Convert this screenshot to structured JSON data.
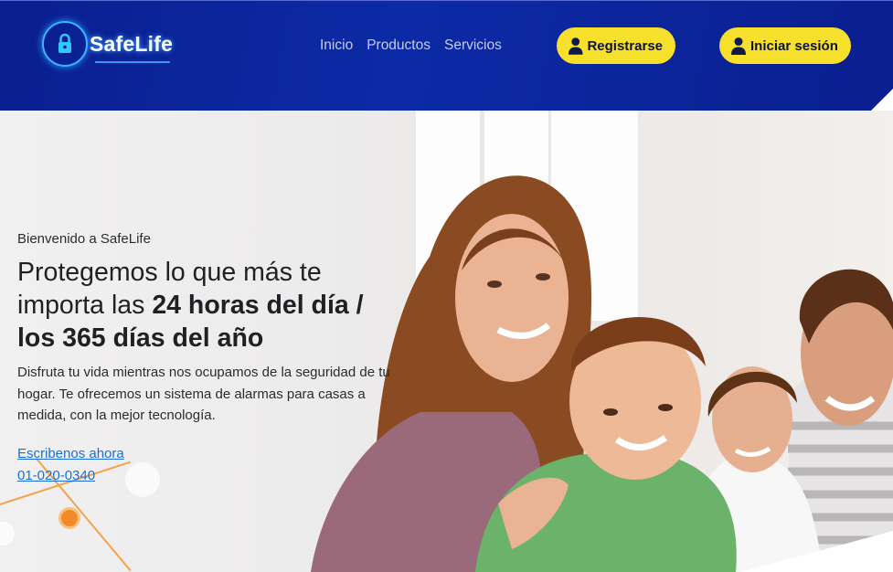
{
  "brand": {
    "name": "SafeLife"
  },
  "icons": {
    "logo": "padlock-circuit-icon",
    "register": "user-icon",
    "login": "user-icon"
  },
  "colors": {
    "header_bg": "#0c2aa6",
    "button_bg": "#f6e02c",
    "link": "#1a6fd6",
    "accent_orange": "#f28a2a"
  },
  "nav": {
    "items": [
      {
        "label": "Inicio"
      },
      {
        "label": "Productos"
      },
      {
        "label": "Servicios"
      }
    ]
  },
  "header": {
    "register_label": "Registrarse",
    "login_label": "Iniciar sesión"
  },
  "hero": {
    "welcome": "Bienvenido a SafeLife",
    "headline_part1": "Protegemos lo que más te importa las ",
    "headline_bold": "24 horas del día / los 365 días del año",
    "description": "Disfruta tu vida mientras nos ocupamos de la seguridad de tu hogar. Te ofrecemos un sistema de alarmas para casas a medida, con la mejor tecnología.",
    "cta_label": "Escribenos ahora",
    "phone": "01-020-0340"
  }
}
